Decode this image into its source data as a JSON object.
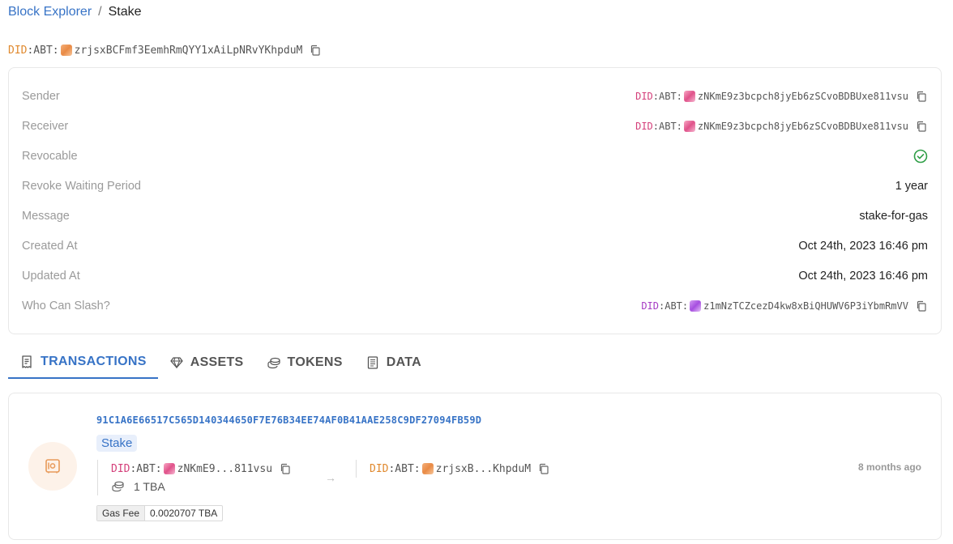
{
  "breadcrumb": {
    "parent": "Block Explorer",
    "separator": "/",
    "current": "Stake"
  },
  "colors": {
    "accent": "#3773c6",
    "did_orange": "#e0892e",
    "did_pink": "#d43f7a",
    "did_purple": "#a63cc4",
    "success": "#2e9e46"
  },
  "header_did": {
    "prefix": "DID",
    "abt": ":ABT:",
    "address": "zrjsxBCFmf3EemhRmQYY1xAiLpNRvYKhpduM"
  },
  "details": {
    "sender": {
      "label": "Sender",
      "prefix": "DID",
      "abt": ":ABT:",
      "address": "zNKmE9z3bcpch8jyEb6zSCvoBDBUxe811vsu"
    },
    "receiver": {
      "label": "Receiver",
      "prefix": "DID",
      "abt": ":ABT:",
      "address": "zNKmE9z3bcpch8jyEb6zSCvoBDBUxe811vsu"
    },
    "revocable": {
      "label": "Revocable",
      "icon": "check-circle-icon"
    },
    "revoke_waiting_period": {
      "label": "Revoke Waiting Period",
      "value": "1 year"
    },
    "message": {
      "label": "Message",
      "value": "stake-for-gas"
    },
    "created_at": {
      "label": "Created At",
      "value": "Oct 24th, 2023 16:46 pm"
    },
    "updated_at": {
      "label": "Updated At",
      "value": "Oct 24th, 2023 16:46 pm"
    },
    "who_can_slash": {
      "label": "Who Can Slash?",
      "prefix": "DID",
      "abt": ":ABT:",
      "address": "z1mNzTCZcezD4kw8xBiQHUWV6P3iYbmRmVV"
    }
  },
  "tabs": [
    {
      "label": "TRANSACTIONS",
      "icon": "receipt-icon",
      "active": true
    },
    {
      "label": "ASSETS",
      "icon": "diamond-icon",
      "active": false
    },
    {
      "label": "TOKENS",
      "icon": "coins-icon",
      "active": false
    },
    {
      "label": "DATA",
      "icon": "document-icon",
      "active": false
    }
  ],
  "transaction": {
    "hash": "91C1A6E66517C565D140344650F7E76B34EE74AF0B41AAE258C9DF27094FB59D",
    "type": "Stake",
    "from": {
      "prefix": "DID",
      "abt": ":ABT:",
      "address": "zNKmE9...811vsu"
    },
    "amount": "1 TBA",
    "arrow": "→",
    "to": {
      "prefix": "DID",
      "abt": ":ABT:",
      "address": "zrjsxB...KhpduM"
    },
    "time": "8 months ago",
    "gas_fee_label": "Gas Fee",
    "gas_fee_value": "0.0020707 TBA"
  }
}
